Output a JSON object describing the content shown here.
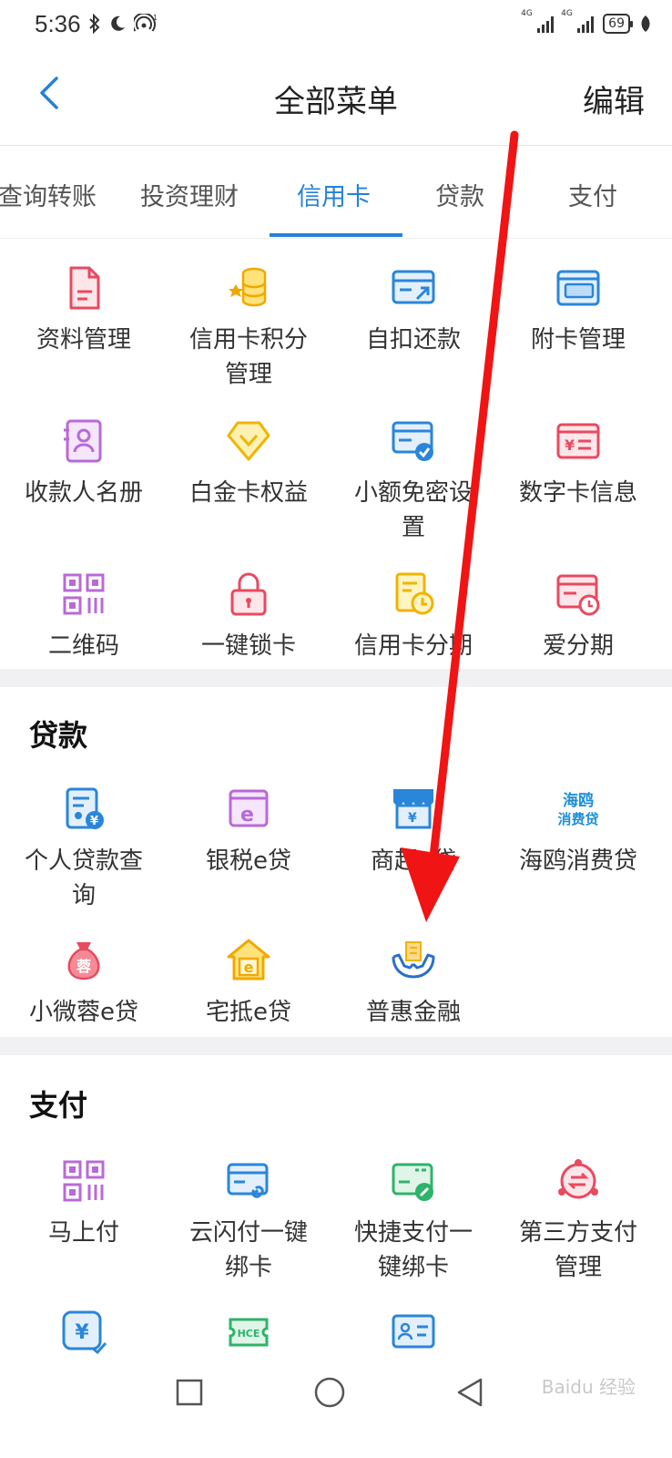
{
  "status": {
    "time": "5:36",
    "battery": "69",
    "net1": "4G",
    "net2": "4G"
  },
  "header": {
    "title": "全部菜单",
    "edit_label": "编辑"
  },
  "tabs": [
    {
      "label": "查询转账"
    },
    {
      "label": "投资理财"
    },
    {
      "label": "信用卡",
      "active": true
    },
    {
      "label": "贷款"
    },
    {
      "label": "支付"
    }
  ],
  "credit": {
    "items": [
      {
        "label": "资料管理",
        "icon": "document-icon"
      },
      {
        "label": "信用卡积分管理",
        "icon": "points-coins-icon"
      },
      {
        "label": "自扣还款",
        "icon": "auto-repay-icon"
      },
      {
        "label": "附卡管理",
        "icon": "card-icon"
      },
      {
        "label": "收款人名册",
        "icon": "contact-book-icon"
      },
      {
        "label": "白金卡权益",
        "icon": "diamond-icon"
      },
      {
        "label": "小额免密设置",
        "icon": "card-check-icon"
      },
      {
        "label": "数字卡信息",
        "icon": "digital-card-icon"
      },
      {
        "label": "二维码",
        "icon": "qr-code-icon"
      },
      {
        "label": "一键锁卡",
        "icon": "lock-icon"
      },
      {
        "label": "信用卡分期",
        "icon": "installment-icon"
      },
      {
        "label": "爱分期",
        "icon": "card-clock-icon"
      }
    ]
  },
  "loans": {
    "title": "贷款",
    "items": [
      {
        "label": "个人贷款查询",
        "icon": "loan-query-icon"
      },
      {
        "label": "银税e贷",
        "icon": "e-loan-icon"
      },
      {
        "label": "商超e贷",
        "icon": "store-icon"
      },
      {
        "label": "海鸥消费贷",
        "icon": "haiou-logo-icon"
      },
      {
        "label": "小微蓉e贷",
        "icon": "money-bag-icon"
      },
      {
        "label": "宅抵e贷",
        "icon": "house-icon"
      },
      {
        "label": "普惠金融",
        "icon": "hands-building-icon"
      }
    ],
    "haiou_logo_line1": "海鸥",
    "haiou_logo_line2": "消费贷",
    "bag_char": "蓉"
  },
  "payment": {
    "title": "支付",
    "items": [
      {
        "label": "马上付",
        "icon": "qr-code-icon"
      },
      {
        "label": "云闪付一键绑卡",
        "icon": "card-link-icon"
      },
      {
        "label": "快捷支付一键绑卡",
        "icon": "card-link-green-icon"
      },
      {
        "label": "第三方支付管理",
        "icon": "exchange-icon"
      },
      {
        "label": "",
        "icon": "yuan-check-icon"
      },
      {
        "label": "",
        "icon": "hce-icon"
      },
      {
        "label": "",
        "icon": "id-card-icon"
      }
    ],
    "hce_text": "HCE"
  },
  "watermark": "Baidu 经验",
  "colors": {
    "accent": "#2680d8",
    "arrow": "#f01414"
  }
}
